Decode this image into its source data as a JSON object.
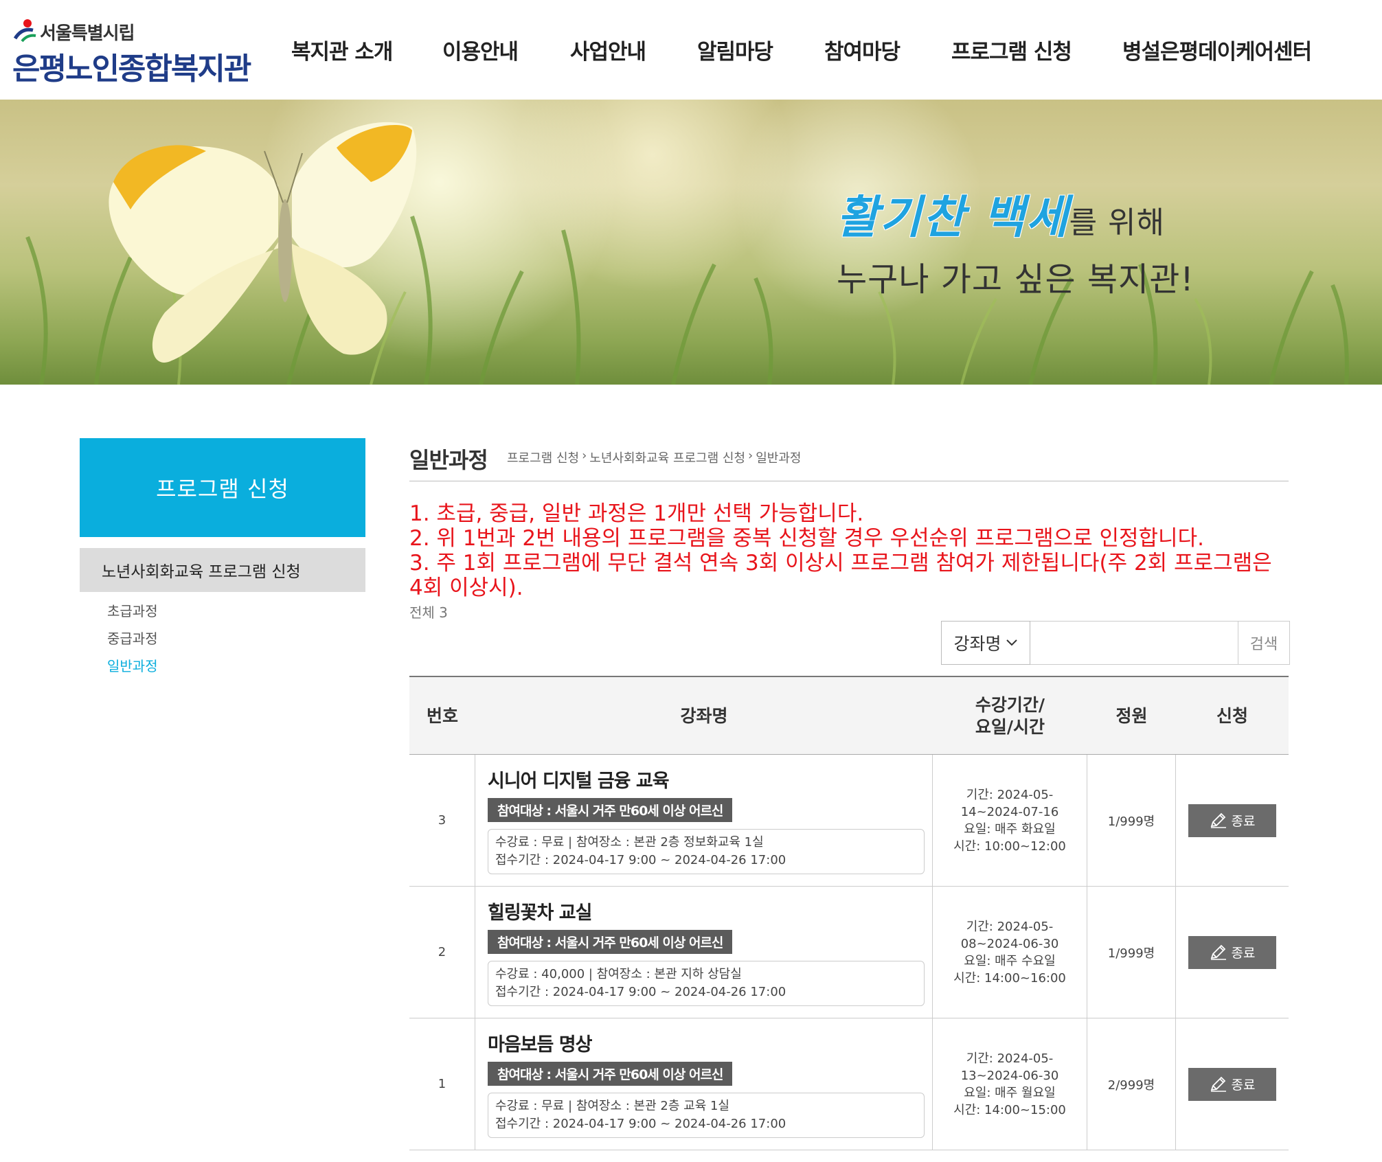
{
  "header": {
    "logo_sub": "서울특별시립",
    "logo_main": "은평노인종합복지관",
    "nav": [
      {
        "label": "복지관 소개"
      },
      {
        "label": "이용안내"
      },
      {
        "label": "사업안내"
      },
      {
        "label": "알림마당"
      },
      {
        "label": "참여마당"
      },
      {
        "label": "프로그램 신청"
      },
      {
        "label": "병설은평데이케어센터"
      }
    ]
  },
  "banner": {
    "accent": "활기찬 백세",
    "line1_rest": "를 위해",
    "line2": "누구나 가고 싶은 복지관!"
  },
  "sidebar": {
    "title": "프로그램 신청",
    "group": "노년사회화교육 프로그램 신청",
    "items": [
      {
        "label": "초급과정"
      },
      {
        "label": "중급과정"
      },
      {
        "label": "일반과정"
      }
    ]
  },
  "content": {
    "title": "일반과정",
    "breadcrumb": [
      "프로그램 신청",
      "노년사회화교육 프로그램 신청",
      "일반과정"
    ],
    "notices": [
      "1. 초급, 중급, 일반 과정은 1개만 선택 가능합니다.",
      "2. 위 1번과 2번 내용의 프로그램을 중복 신청할 경우 우선순위 프로그램으로 인정합니다.",
      "3. 주 1회 프로그램에 무단 결석 연속 3회 이상시 프로그램 참여가 제한됩니다(주 2회 프로그램은 4회 이상시)."
    ],
    "total": "전체 3"
  },
  "search": {
    "select_value": "강좌명",
    "input_value": "",
    "button": "검색"
  },
  "table": {
    "headers": {
      "no": "번호",
      "name": "강좌명",
      "period_line1": "수강기간/",
      "period_line2": "요일/시간",
      "capacity": "정원",
      "apply": "신청"
    },
    "rows": [
      {
        "no": "3",
        "title": "시니어 디지털 금융 교육",
        "target": "참여대상 : 서울시 거주 만60세 이상 어르신",
        "info1": "수강료 : 무료 | 참여장소 : 본관 2층 정보화교육 1실",
        "info2": "접수기간 : 2024-04-17 9:00 ~ 2024-04-26 17:00",
        "period1": "기간: 2024-05-",
        "period2": "14~2024-07-16",
        "day": "요일: 매주 화요일",
        "time": "시간: 10:00~12:00",
        "capacity": "1/999명",
        "status": "종료"
      },
      {
        "no": "2",
        "title": "힐링꽃차 교실",
        "target": "참여대상 : 서울시 거주 만60세 이상 어르신",
        "info1": "수강료 : 40,000 | 참여장소 : 본관 지하 상담실",
        "info2": "접수기간 : 2024-04-17 9:00 ~ 2024-04-26 17:00",
        "period1": "기간: 2024-05-",
        "period2": "08~2024-06-30",
        "day": "요일: 매주 수요일",
        "time": "시간: 14:00~16:00",
        "capacity": "1/999명",
        "status": "종료"
      },
      {
        "no": "1",
        "title": "마음보듬 명상",
        "target": "참여대상 : 서울시 거주 만60세 이상 어르신",
        "info1": "수강료 : 무료 | 참여장소 : 본관 2층 교육 1실",
        "info2": "접수기간 : 2024-04-17 9:00 ~ 2024-04-26 17:00",
        "period1": "기간: 2024-05-",
        "period2": "13~2024-06-30",
        "day": "요일: 매주 월요일",
        "time": "시간: 14:00~15:00",
        "capacity": "2/999명",
        "status": "종료"
      }
    ]
  },
  "colors": {
    "accent": "#0aaedd",
    "notice": "#e8141b",
    "logo": "#1f3c88",
    "button": "#6b6b6b"
  }
}
